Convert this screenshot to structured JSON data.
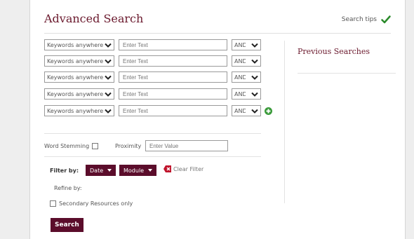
{
  "header": {
    "title": "Advanced Search",
    "tips": "Search tips"
  },
  "rows": [
    {
      "field": "Keywords anywhere",
      "placeholder": "Enter Text",
      "op": "AND"
    },
    {
      "field": "Keywords anywhere",
      "placeholder": "Enter Text",
      "op": "AND"
    },
    {
      "field": "Keywords anywhere",
      "placeholder": "Enter Text",
      "op": "AND"
    },
    {
      "field": "Keywords anywhere",
      "placeholder": "Enter Text",
      "op": "AND"
    },
    {
      "field": "Keywords anywhere",
      "placeholder": "Enter Text",
      "op": "AND"
    }
  ],
  "previous": {
    "title": "Previous Searches"
  },
  "options": {
    "stemming": "Word Stemming",
    "proximity": "Proximity",
    "proximity_placeholder": "Enter Value"
  },
  "filter": {
    "label": "Filter by:",
    "date": "Date",
    "module": "Module",
    "clear": "Clear Filter"
  },
  "refine": {
    "label": "Refine by:",
    "secondary": "Secondary Resources only"
  },
  "search_button": "Search",
  "colors": {
    "brand": "#5b0d2b",
    "title": "#6b1a2e",
    "check": "#2a8a2a",
    "clear": "#c0142c"
  }
}
